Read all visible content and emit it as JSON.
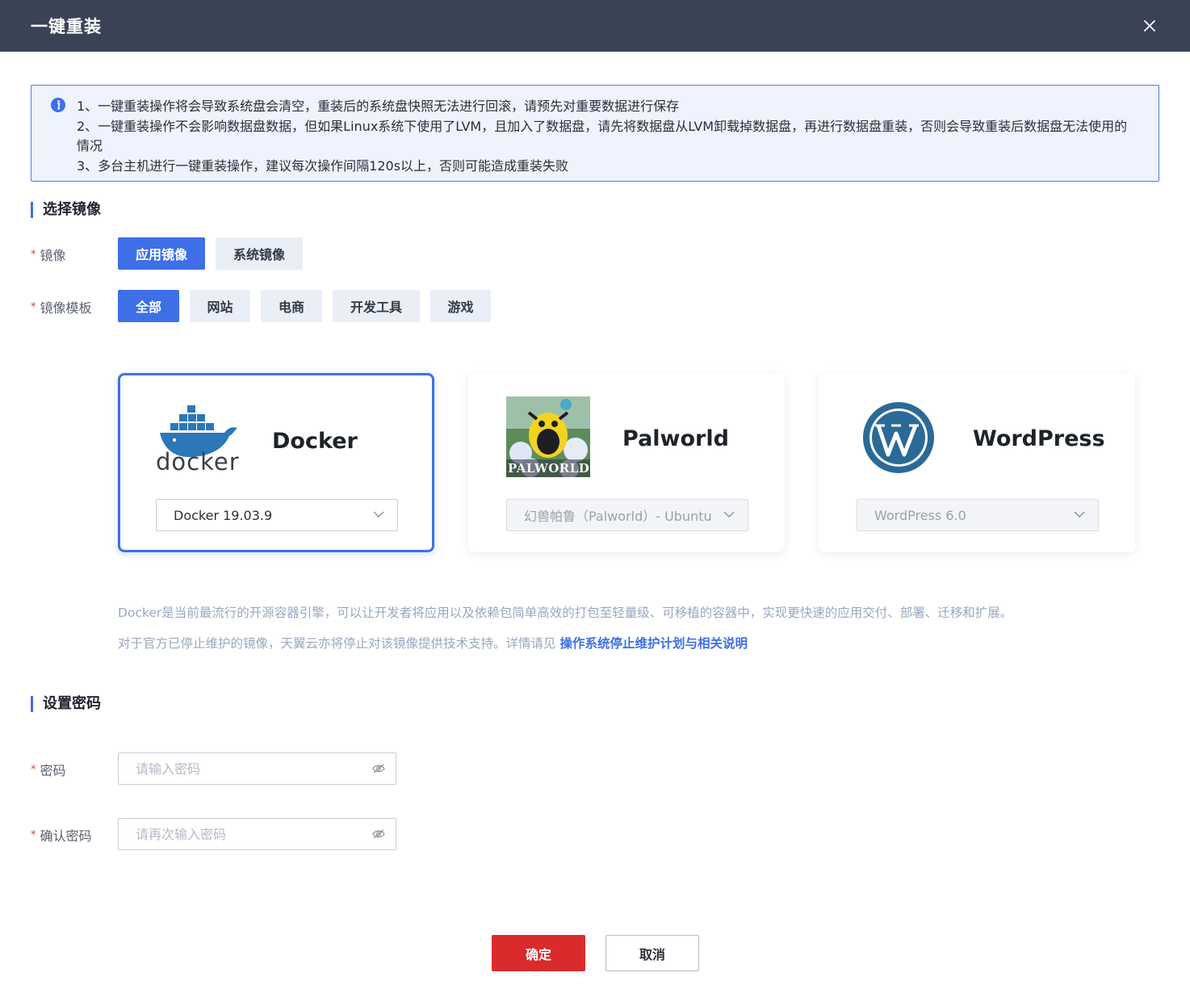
{
  "dialog": {
    "title": "一键重装"
  },
  "notice": {
    "line1": "1、一键重装操作将会导致系统盘会清空，重装后的系统盘快照无法进行回滚，请预先对重要数据进行保存",
    "line2": "2、一键重装操作不会影响数据盘数据，但如果Linux系统下使用了LVM，且加入了数据盘，请先将数据盘从LVM卸载掉数据盘，再进行数据盘重装，否则会导致重装后数据盘无法使用的情况",
    "line3": "3、多台主机进行一键重装操作，建议每次操作间隔120s以上，否则可能造成重装失败"
  },
  "image_section": {
    "title": "选择镜像",
    "image_label": "镜像",
    "image_types": [
      "应用镜像",
      "系统镜像"
    ],
    "template_label": "镜像模板",
    "templates": [
      "全部",
      "网站",
      "电商",
      "开发工具",
      "游戏"
    ]
  },
  "cards": [
    {
      "name": "Docker",
      "selected_version": "Docker 19.03.9",
      "logo_text": "docker"
    },
    {
      "name": "Palworld",
      "selected_version": "幻兽帕鲁（Palworld）- Ubuntu",
      "logo_text": "PALWORLD"
    },
    {
      "name": "WordPress",
      "selected_version": "WordPress 6.0"
    }
  ],
  "description": {
    "line1": "Docker是当前最流行的开源容器引擎，可以让开发者将应用以及依赖包简单高效的打包至轻量级、可移植的容器中，实现更快速的应用交付、部署、迁移和扩展。",
    "line2_prefix": "对于官方已停止维护的镜像，天翼云亦将停止对该镜像提供技术支持。详情请见 ",
    "link_text": "操作系统停止维护计划与相关说明"
  },
  "password_section": {
    "title": "设置密码",
    "password_label": "密码",
    "password_placeholder": "请输入密码",
    "confirm_label": "确认密码",
    "confirm_placeholder": "请再次输入密码"
  },
  "footer": {
    "ok_label": "确定",
    "cancel_label": "取消"
  },
  "colors": {
    "header_bg": "#3a4256",
    "accent": "#3e6fe6",
    "ok_button": "#d92b2b",
    "required_star": "#e03a3a"
  }
}
